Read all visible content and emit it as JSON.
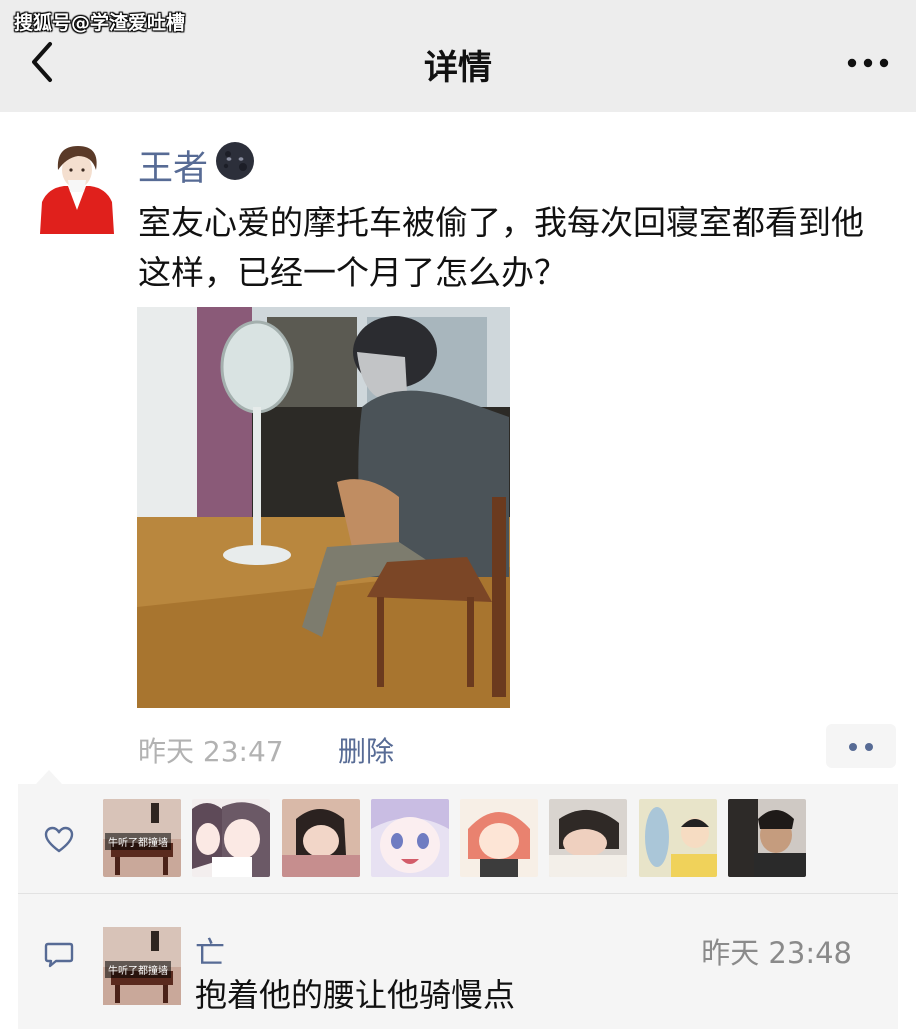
{
  "watermark": "搜狐号@学渣爱吐槽",
  "nav": {
    "title": "详情",
    "back_icon": "chevron-left-icon",
    "more_icon": "more-horizontal-icon"
  },
  "post": {
    "author": "王者",
    "author_badge_icon": "new-moon-face-icon",
    "text": "室友心爱的摩托车被偷了，我每次回寝室都看到他这样，已经一个月了怎么办？",
    "time": "昨天 23:47",
    "delete_label": "删除"
  },
  "likes": {
    "icon": "heart-icon",
    "avatar_caption": "牛听了都撞墙"
  },
  "comments": [
    {
      "author": "亡",
      "time": "昨天 23:48",
      "text": "抱着他的腰让他骑慢点",
      "avatar_caption": "牛听了都撞墙"
    }
  ],
  "colors": {
    "link": "#576b95",
    "nav_bg": "#ededed",
    "panel_bg": "#f5f5f5"
  }
}
